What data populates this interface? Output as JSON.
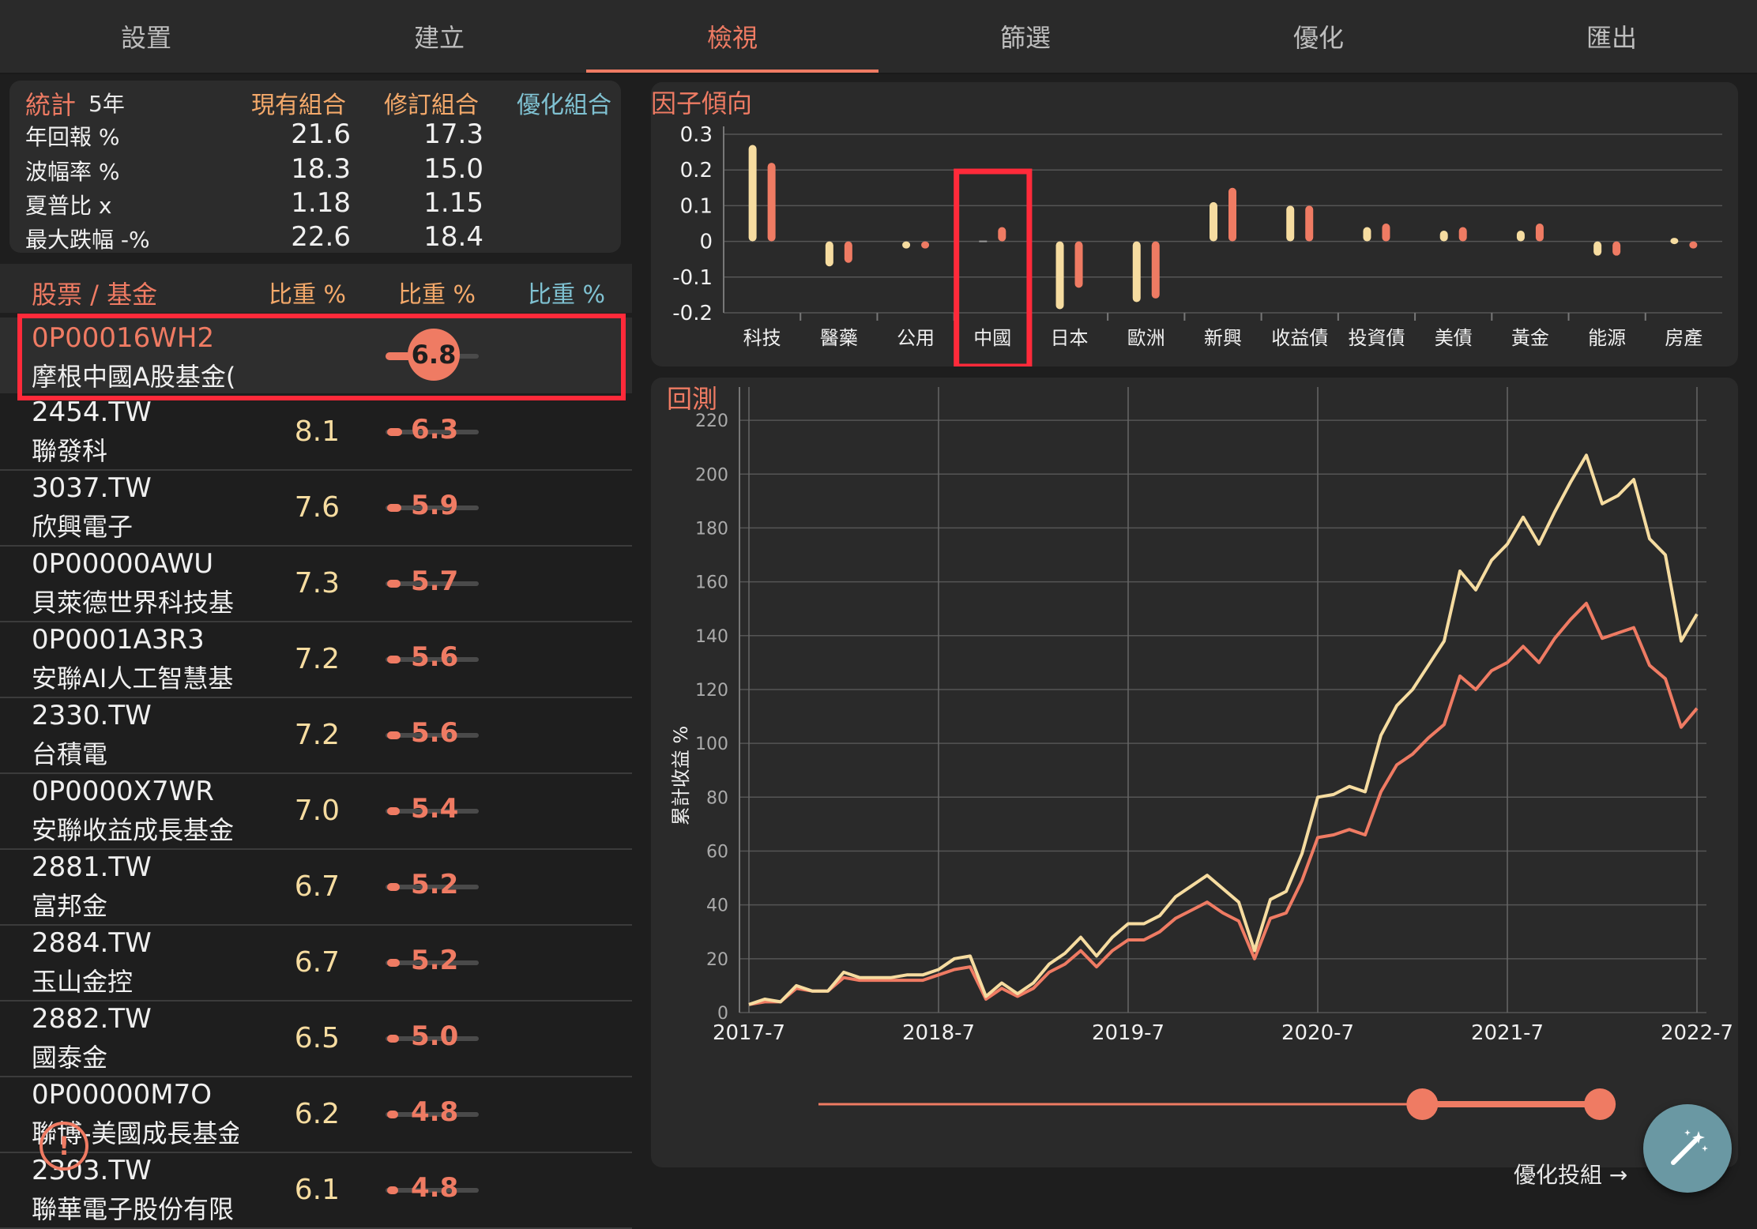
{
  "tabs": [
    {
      "label": "設置"
    },
    {
      "label": "建立"
    },
    {
      "label": "檢視"
    },
    {
      "label": "篩選"
    },
    {
      "label": "優化"
    },
    {
      "label": "匯出"
    }
  ],
  "stats": {
    "title": "統計",
    "period": "5年",
    "col_current": "現有組合",
    "col_revised": "修訂組合",
    "col_optimized": "優化組合",
    "rows": [
      {
        "label": "年回報 %",
        "current": "21.6",
        "revised": "17.3"
      },
      {
        "label": "波幅率 %",
        "current": "18.3",
        "revised": "15.0"
      },
      {
        "label": "夏普比 x",
        "current": "1.18",
        "revised": "1.15"
      },
      {
        "label": "最大跌幅 -%",
        "current": "22.6",
        "revised": "18.4"
      }
    ]
  },
  "holdings": {
    "header": "股票 / 基金",
    "col1": "比重 %",
    "col2": "比重 %",
    "col3": "比重 %",
    "selected": {
      "code": "0P00016WH2",
      "name": "摩根中國A股基金(",
      "weight_revised": "6.8",
      "slider_fraction": 0.36
    },
    "rows": [
      {
        "code": "2454.TW",
        "name": "聯發科",
        "w1": "8.1",
        "w2": "6.3"
      },
      {
        "code": "3037.TW",
        "name": "欣興電子",
        "w1": "7.6",
        "w2": "5.9"
      },
      {
        "code": "0P00000AWU",
        "name": "貝萊德世界科技基",
        "w1": "7.3",
        "w2": "5.7"
      },
      {
        "code": "0P0001A3R3",
        "name": "安聯AI人工智慧基",
        "w1": "7.2",
        "w2": "5.6"
      },
      {
        "code": "2330.TW",
        "name": "台積電",
        "w1": "7.2",
        "w2": "5.6"
      },
      {
        "code": "0P0000X7WR",
        "name": "安聯收益成長基金",
        "w1": "7.0",
        "w2": "5.4"
      },
      {
        "code": "2881.TW",
        "name": "富邦金",
        "w1": "6.7",
        "w2": "5.2"
      },
      {
        "code": "2884.TW",
        "name": "玉山金控",
        "w1": "6.7",
        "w2": "5.2"
      },
      {
        "code": "2882.TW",
        "name": "國泰金",
        "w1": "6.5",
        "w2": "5.0"
      },
      {
        "code": "0P00000M7O",
        "name": "聯博-美國成長基金",
        "w1": "6.2",
        "w2": "4.8"
      },
      {
        "code": "2303.TW",
        "name": "聯華電子股份有限",
        "w1": "6.1",
        "w2": "4.8"
      }
    ]
  },
  "factor": {
    "title": "因子傾向",
    "categories": [
      "科技",
      "醫藥",
      "公用",
      "中國",
      "日本",
      "歐洲",
      "新興",
      "收益債",
      "投資債",
      "美債",
      "黃金",
      "能源",
      "房產"
    ],
    "y_ticks": [
      "0.3",
      "0.2",
      "0.1",
      "0",
      "-0.1",
      "-0.2"
    ],
    "ylim": [
      -0.2,
      0.3
    ],
    "current": [
      0.27,
      -0.07,
      -0.02,
      0.0,
      -0.19,
      -0.17,
      0.11,
      0.1,
      0.04,
      0.03,
      0.03,
      -0.04,
      0.01
    ],
    "revised": [
      0.22,
      -0.06,
      -0.02,
      0.04,
      -0.13,
      -0.16,
      0.15,
      0.1,
      0.05,
      0.04,
      0.05,
      -0.04,
      -0.02
    ],
    "highlight": "中國"
  },
  "backtest": {
    "title": "回測",
    "ylabel": "累計收益 %",
    "y_ticks": [
      "0",
      "20",
      "40",
      "60",
      "80",
      "100",
      "120",
      "140",
      "160",
      "180",
      "200",
      "220"
    ],
    "x_ticks": [
      "2017-7",
      "2018-7",
      "2019-7",
      "2020-7",
      "2021-7",
      "2022-7"
    ],
    "ylim": [
      0,
      230
    ],
    "current": [
      3,
      5,
      4,
      10,
      8,
      8,
      15,
      13,
      13,
      13,
      14,
      14,
      16,
      20,
      21,
      6,
      11,
      7,
      11,
      18,
      22,
      28,
      21,
      28,
      33,
      33,
      36,
      43,
      47,
      51,
      46,
      41,
      23,
      42,
      45,
      59,
      80,
      81,
      84,
      82,
      103,
      114,
      120,
      129,
      138,
      164,
      157,
      168,
      174,
      184,
      174,
      186,
      197,
      207,
      189,
      192,
      198,
      176,
      170,
      138,
      148
    ],
    "revised": [
      3,
      4,
      4,
      9,
      8,
      8,
      13,
      12,
      12,
      12,
      12,
      12,
      14,
      16,
      17,
      5,
      9,
      6,
      9,
      15,
      18,
      23,
      17,
      23,
      27,
      27,
      30,
      35,
      38,
      41,
      37,
      34,
      20,
      35,
      37,
      49,
      65,
      66,
      68,
      66,
      82,
      92,
      96,
      102,
      107,
      125,
      120,
      127,
      130,
      136,
      130,
      139,
      146,
      152,
      139,
      141,
      143,
      129,
      124,
      106,
      113
    ],
    "range_start": 0.68,
    "range_end": 0.88,
    "optimize_label": "優化投組 →"
  },
  "colors": {
    "current": "#f6dca0",
    "revised": "#ef7b63",
    "optimized": "#7fc1d1",
    "highlight": "#ff2a3a"
  }
}
